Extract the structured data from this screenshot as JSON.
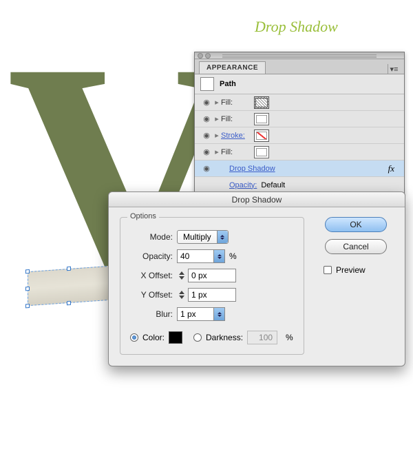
{
  "page_title": "Drop Shadow",
  "appearance": {
    "panel_title": "APPEARANCE",
    "header": "Path",
    "rows": [
      {
        "label": "Fill:",
        "link": false,
        "swatch": "pattern1"
      },
      {
        "label": "Fill:",
        "link": false,
        "swatch": "plain"
      },
      {
        "label": "Stroke:",
        "link": true,
        "swatch": "none"
      },
      {
        "label": "Fill:",
        "link": false,
        "swatch": "plain"
      }
    ],
    "effect": {
      "label": "Drop Shadow",
      "icon": "fx"
    },
    "opacity": {
      "label": "Opacity:",
      "value": "Default"
    }
  },
  "dialog": {
    "title": "Drop Shadow",
    "options_legend": "Options",
    "mode_label": "Mode:",
    "mode_value": "Multiply",
    "opacity_label": "Opacity:",
    "opacity_value": "40",
    "opacity_unit": "%",
    "xoffset_label": "X Offset:",
    "xoffset_value": "0 px",
    "yoffset_label": "Y Offset:",
    "yoffset_value": "1 px",
    "blur_label": "Blur:",
    "blur_value": "1 px",
    "color_label": "Color:",
    "darkness_label": "Darkness:",
    "darkness_value": "100",
    "darkness_unit": "%",
    "ok_label": "OK",
    "cancel_label": "Cancel",
    "preview_label": "Preview"
  }
}
